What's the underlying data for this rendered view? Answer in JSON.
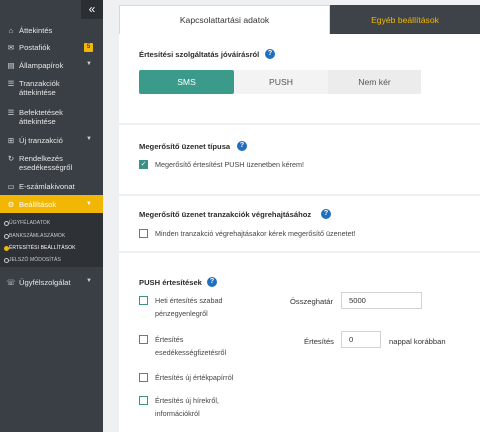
{
  "sidebar": {
    "collapse_icon": "«",
    "items": [
      {
        "label": "Áttekintés",
        "icon": "home-icon"
      },
      {
        "label": "Postafiók",
        "icon": "envelope-icon",
        "badge": "5"
      },
      {
        "label": "Állampapírok",
        "icon": "chart-icon"
      },
      {
        "label": "Tranzakciók áttekintése",
        "icon": "list-icon"
      },
      {
        "label": "Befektetések áttekintése",
        "icon": "list-icon"
      },
      {
        "label": "Új tranzakció",
        "icon": "cart-icon"
      },
      {
        "label": "Rendelkezés esedékességről",
        "icon": "refresh-icon"
      },
      {
        "label": "E-számlakivonat",
        "icon": "document-icon"
      },
      {
        "label": "Beállítások",
        "icon": "gear-icon"
      },
      {
        "label": "Ügyfélszolgálat",
        "icon": "chat-icon"
      }
    ],
    "submenu": [
      "ÜGYFÉLADATOK",
      "BANKSZÁMLASZÁMOK",
      "ÉRTESÍTÉSI BEÁLLÍTÁSOK",
      "JELSZÓ MÓDOSÍTÁS"
    ]
  },
  "tabs": {
    "contact": "Kapcsolattartási adatok",
    "other": "Egyéb beállítások"
  },
  "section_service": {
    "title": "Értesítési szolgáltatás jóváírásról",
    "options": [
      "SMS",
      "PUSH",
      "Nem kér"
    ],
    "selected": "SMS"
  },
  "section_confirm": {
    "title": "Megerősítő üzenet típusa",
    "checkbox_label": "Megerősítő értesítést PUSH üzenetben kérem!",
    "checked": true
  },
  "section_tx": {
    "title": "Megerősítő üzenet tranzakciók végrehajtásához",
    "checkbox_label": "Minden tranzakció végrehajtásakor kérek megerősítő üzenetet!",
    "checked": false
  },
  "section_push": {
    "title": "PUSH értesítések",
    "weekly": "Heti értesítés szabad pénzegyenlegről",
    "due": "Értesítés esedékességfizetésről",
    "securities": "Értesítés új értékpapírról",
    "news": "Értesítés új hírekről, információkról",
    "threshold_label": "Összeghatár",
    "threshold_value": "5000",
    "notify_label": "Értesítés",
    "notify_value": "0",
    "days_label": "nappal korábban"
  },
  "colors": {
    "sidebar": "#3a3f45",
    "accent": "#f2b705",
    "teal": "#3a9b8a",
    "help": "#1f6fc0"
  }
}
